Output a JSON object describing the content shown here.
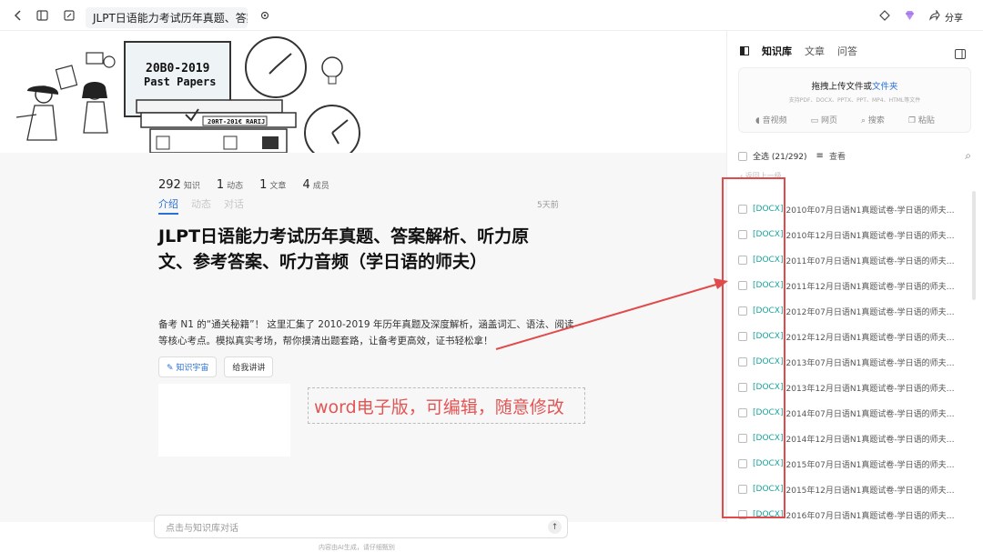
{
  "topbar": {
    "title": "JLPT日语能力考试历年真题、答案…",
    "share_label": "分享"
  },
  "hero": {
    "poster_title_1": "20B0-2019",
    "poster_title_2": "Past Papers",
    "book_label": "20RT-201€ RARIJ"
  },
  "stats": [
    {
      "num": "292",
      "unit": "知识"
    },
    {
      "num": "1",
      "unit": "动态"
    },
    {
      "num": "1",
      "unit": "文章"
    },
    {
      "num": "4",
      "unit": "成员"
    }
  ],
  "tabs": [
    "介绍",
    "动态",
    "对话"
  ],
  "ago": "5天前",
  "title": "JLPT日语能力考试历年真题、答案解析、听力原文、参考答案、听力音频（学日语的师夫）",
  "description": "备考 N1 的“通关秘籍”！ 这里汇集了 2010-2019 年历年真题及深度解析，涵盖词汇、语法、阅读等核心考点。模拟真实考场，帮你摸清出题套路，让备考更高效，证书轻松拿！",
  "buttons": {
    "knowledge": "知识宇宙",
    "explain": "给我讲讲"
  },
  "annotation": "word电子版，可编辑，随意修改",
  "chat": {
    "placeholder": "点击与知识库对话",
    "footnote": "内容由AI生成，请仔细甄别"
  },
  "panel": {
    "tabs": [
      "知识库",
      "文章",
      "问答"
    ],
    "upload_title": "拖拽上传文件或",
    "upload_link": "文件夹",
    "upload_sub": "支持PDF、DOCX、PPTX、PPT、MP4、HTML等文件",
    "actions": [
      "音视频",
      "网页",
      "搜索",
      "粘贴"
    ],
    "select_all": "全选 (21/292)",
    "view": "查看",
    "back": "返回上一级",
    "docs": [
      {
        "tag": "[DOCX]",
        "name": "2010年07月日语N1真题试卷-学日语的师夫…"
      },
      {
        "tag": "[DOCX]",
        "name": "2010年12月日语N1真题试卷-学日语的师夫…"
      },
      {
        "tag": "[DOCX]",
        "name": "2011年07月日语N1真题试卷-学日语的师夫…"
      },
      {
        "tag": "[DOCX]",
        "name": "2011年12月日语N1真题试卷-学日语的师夫…"
      },
      {
        "tag": "[DOCX]",
        "name": "2012年07月日语N1真题试卷-学日语的师夫…"
      },
      {
        "tag": "[DOCX]",
        "name": "2012年12月日语N1真题试卷-学日语的师夫…"
      },
      {
        "tag": "[DOCX]",
        "name": "2013年07月日语N1真题试卷-学日语的师夫…"
      },
      {
        "tag": "[DOCX]",
        "name": "2013年12月日语N1真题试卷-学日语的师夫…"
      },
      {
        "tag": "[DOCX]",
        "name": "2014年07月日语N1真题试卷-学日语的师夫…"
      },
      {
        "tag": "[DOCX]",
        "name": "2014年12月日语N1真题试卷-学日语的师夫…"
      },
      {
        "tag": "[DOCX]",
        "name": "2015年07月日语N1真题试卷-学日语的师夫…"
      },
      {
        "tag": "[DOCX]",
        "name": "2015年12月日语N1真题试卷-学日语的师夫…"
      },
      {
        "tag": "[DOCX]",
        "name": "2016年07月日语N1真题试卷-学日语的师夫…"
      }
    ]
  },
  "colors": {
    "accent": "#2a6fd6",
    "annotation_red": "#e14a4a",
    "docx_tag": "#16a39a"
  }
}
